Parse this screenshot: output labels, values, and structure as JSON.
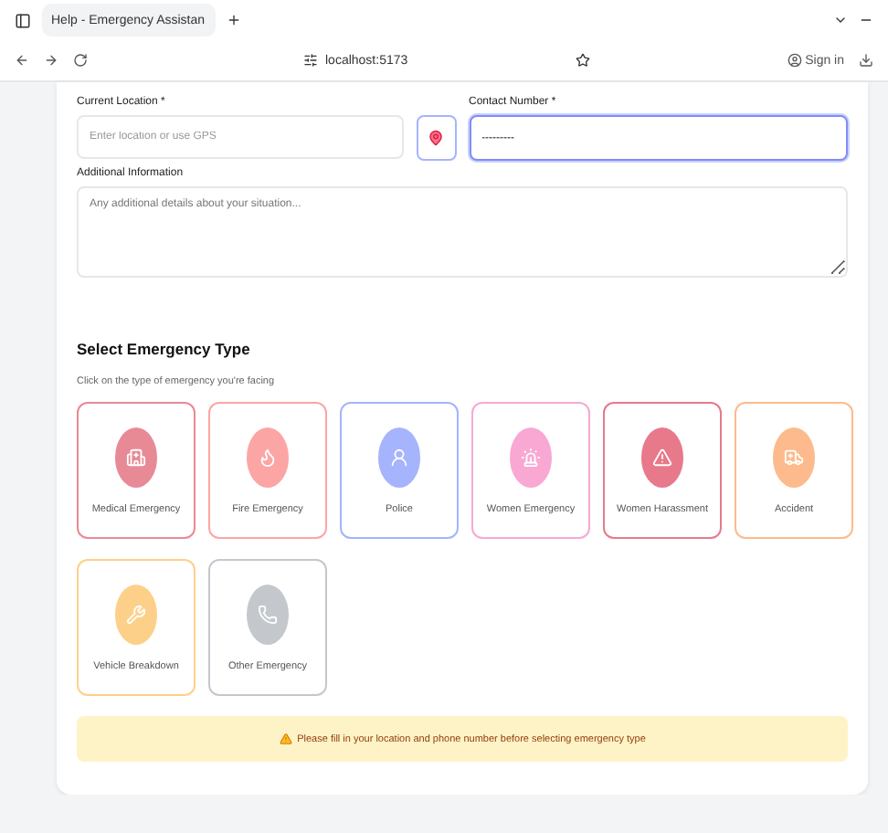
{
  "browser": {
    "tab_title": "Help - Emergency Assistan",
    "address": "localhost:5173",
    "profile": "Sign in"
  },
  "form": {
    "location": {
      "label": "Current Location *",
      "placeholder": "Enter location or use GPS"
    },
    "contact": {
      "label": "Contact Number *",
      "value": "---------",
      "focused": true
    },
    "info": {
      "label": "Additional Information",
      "placeholder": "Any additional details about your situation..."
    }
  },
  "emergency": {
    "title": "Select Emergency Type",
    "subtitle": "Click on the type of emergency you're facing",
    "types": [
      {
        "kind": "medical",
        "label": "Medical Emergency",
        "color": "#e88a95"
      },
      {
        "kind": "fire",
        "label": "Fire Emergency",
        "color": "#fca5a5"
      },
      {
        "kind": "police",
        "label": "Police",
        "color": "#a5b4fc"
      },
      {
        "kind": "siren",
        "label": "Women Emergency",
        "color": "#f9a8d4"
      },
      {
        "kind": "alert",
        "label": "Women Harassment",
        "color": "#e8798a"
      },
      {
        "kind": "ambulance",
        "label": "Accident",
        "color": "#fdba8c"
      },
      {
        "kind": "wrench",
        "label": "Vehicle Breakdown",
        "color": "#fdd08a"
      },
      {
        "kind": "phone",
        "label": "Other Emergency",
        "color": "#c4c7cc"
      }
    ]
  },
  "notice": "Please fill in your location and phone number before selecting emergency type"
}
